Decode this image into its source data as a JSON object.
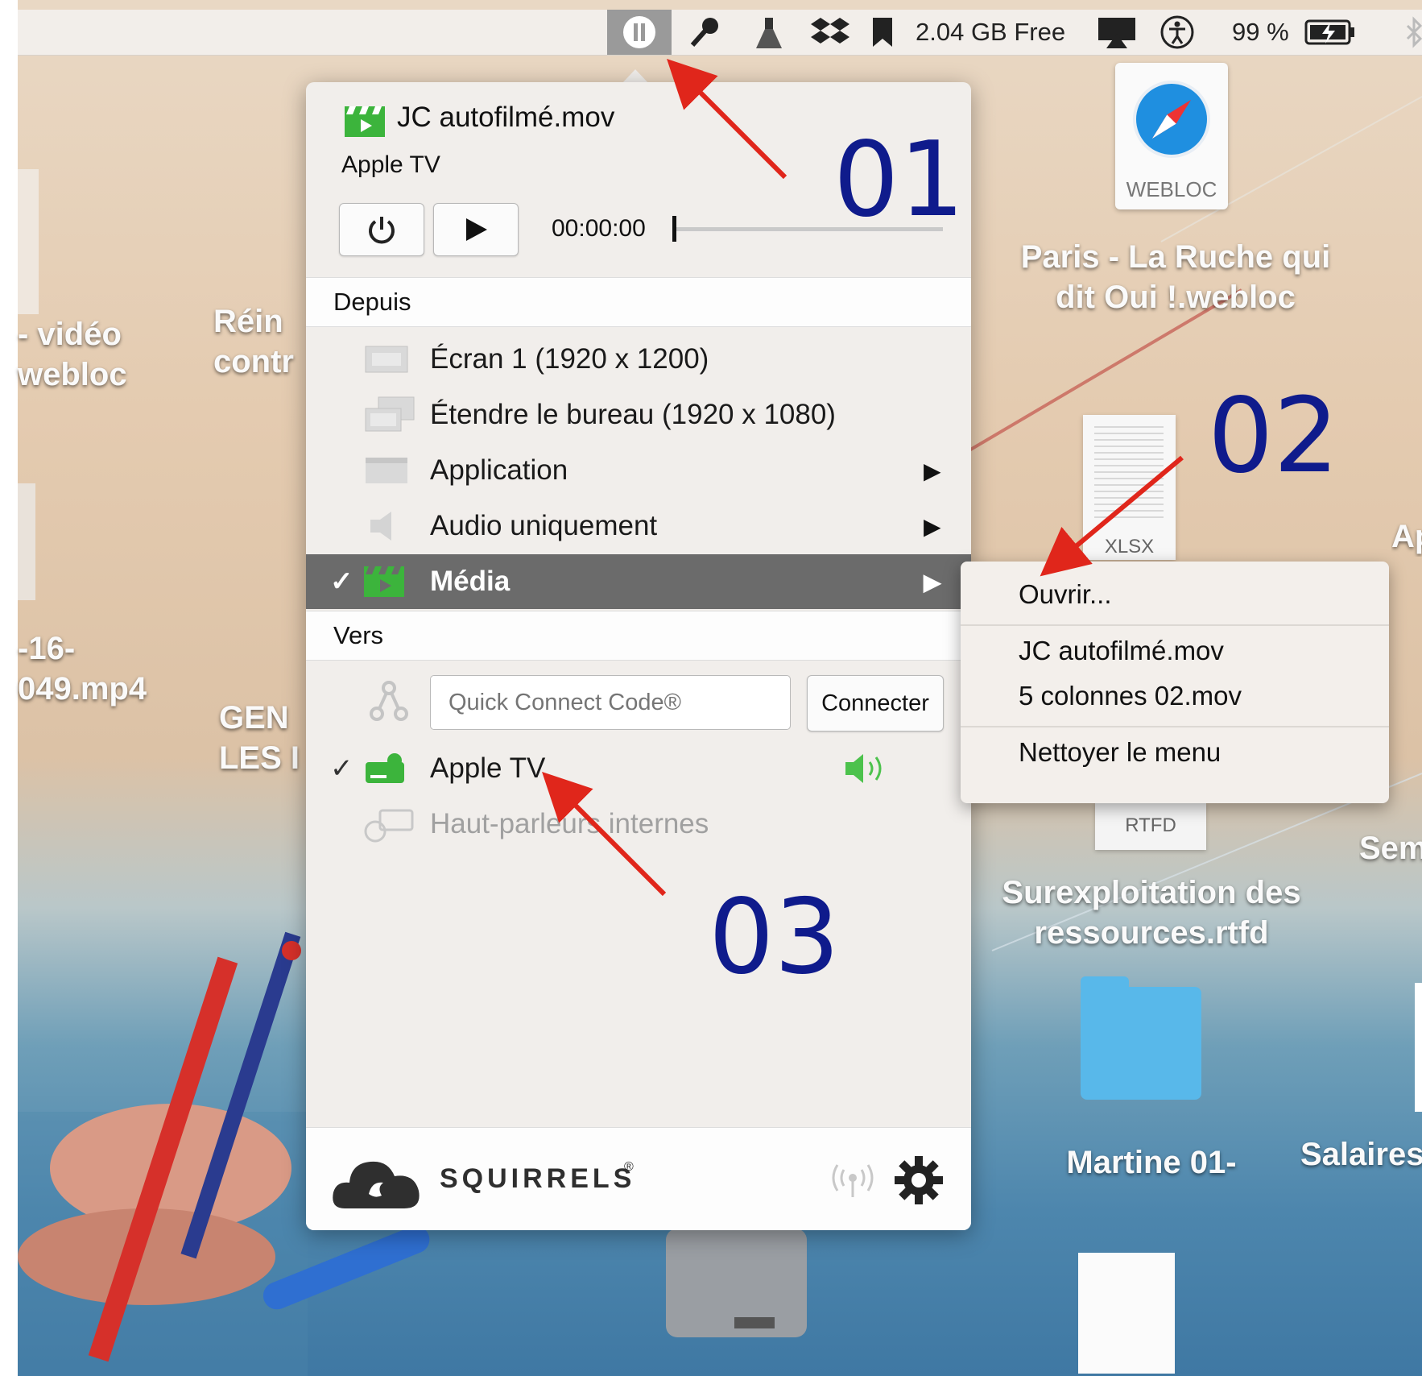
{
  "menubar": {
    "storage": "2.04 GB Free",
    "battery": "99 %"
  },
  "desktop": {
    "labels": [
      {
        "key": "video",
        "text": "- vidéo\nwebloc"
      },
      {
        "key": "rein",
        "text": "Réin\ncontr"
      },
      {
        "key": "mp4",
        "text": "-16-\n049.mp4"
      },
      {
        "key": "gen",
        "text": "GEN\nLES I"
      },
      {
        "key": "webloc",
        "text": "Paris - La Ruche qui\ndit Oui !.webloc"
      },
      {
        "key": "ap",
        "text": "Ap"
      },
      {
        "key": "rtfd",
        "text": "Surexploitation des\nressources.rtfd"
      },
      {
        "key": "sem",
        "text": "Sem"
      },
      {
        "key": "martine",
        "text": "Martine 01-"
      },
      {
        "key": "salaires",
        "text": "Salaires"
      }
    ],
    "file_badges": {
      "webloc": "WEBLOC",
      "xlsx": "XLSX",
      "rtfd": "RTFD"
    }
  },
  "popover": {
    "now_playing": "JC autofilmé.mov",
    "target_name": "Apple TV",
    "timecode": "00:00:00",
    "from_header": "Depuis",
    "sources": [
      {
        "label": "Écran 1 (1920 x 1200)",
        "icon": "screen-icon",
        "submenu": false,
        "selected": false
      },
      {
        "label": "Étendre le bureau (1920 x 1080)",
        "icon": "extend-desktop-icon",
        "submenu": false,
        "selected": false
      },
      {
        "label": "Application",
        "icon": "application-icon",
        "submenu": true,
        "selected": false
      },
      {
        "label": "Audio uniquement",
        "icon": "speaker-icon",
        "submenu": true,
        "selected": false
      },
      {
        "label": "Média",
        "icon": "media-clapper-icon",
        "submenu": true,
        "selected": true
      }
    ],
    "to_header": "Vers",
    "quick_connect_placeholder": "Quick Connect Code®",
    "connect_button": "Connecter",
    "targets": [
      {
        "label": "Apple TV",
        "selected": true
      },
      {
        "label": "Haut-parleurs internes",
        "selected": false
      }
    ],
    "brand": "SQUIRRELS",
    "brand_mark": "®"
  },
  "submenu": {
    "open": "Ouvrir...",
    "recent": [
      "JC autofilmé.mov",
      "5 colonnes 02.mov"
    ],
    "clear": "Nettoyer le menu"
  },
  "annotations": [
    "01",
    "02",
    "03"
  ],
  "colors": {
    "accent_green": "#3cb43c",
    "selection_gray": "#6b6b6b",
    "annotation_blue": "#0f1b8c",
    "arrow_red": "#e0261b"
  }
}
